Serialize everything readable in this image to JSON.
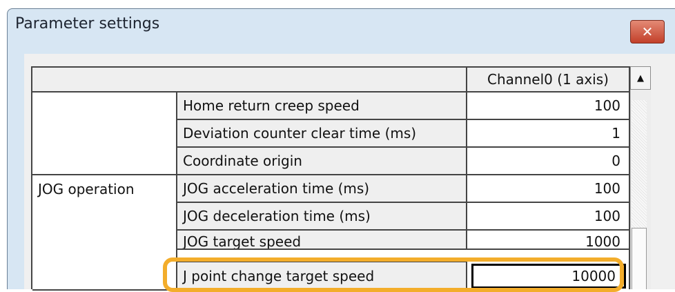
{
  "window": {
    "title": "Parameter settings",
    "close_glyph": "✕",
    "close_color": "#c94b36",
    "frame_color": "#d7e6f3"
  },
  "grid": {
    "column_header": "Channel0 (1 axis)",
    "rows": [
      {
        "group": "",
        "label": "Home return creep speed",
        "value": "100"
      },
      {
        "group": "",
        "label": "Deviation counter clear time (ms)",
        "value": "1"
      },
      {
        "group": "",
        "label": "Coordinate origin",
        "value": "0"
      },
      {
        "group": "JOG operation",
        "label": "JOG acceleration time (ms)",
        "value": "100"
      },
      {
        "group": "",
        "label": "JOG deceleration time (ms)",
        "value": "100"
      },
      {
        "group": "",
        "label": "JOG target speed",
        "value": "1000"
      },
      {
        "group": "",
        "label": "J point change target speed",
        "value": "10000"
      }
    ],
    "highlight_color": "#f3ad2b"
  },
  "scrollbar": {
    "up_arrow_glyph": "▲"
  }
}
